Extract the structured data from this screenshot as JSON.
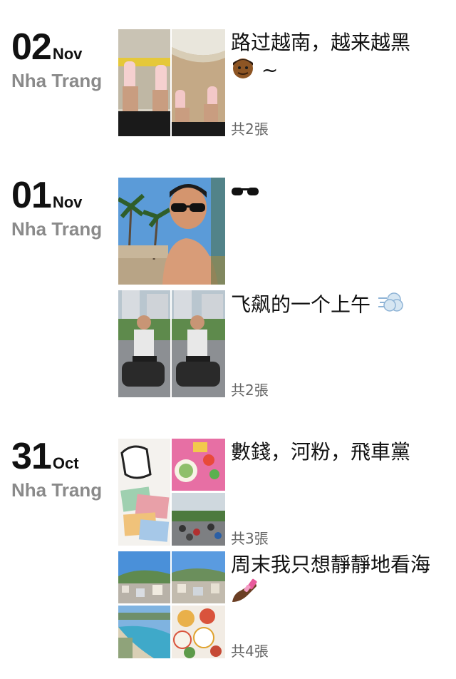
{
  "entries": [
    {
      "day": "02",
      "month": "Nov",
      "place": "Nha Trang",
      "posts": [
        {
          "caption": "路过越南，越来越黑",
          "caption_tail": "~",
          "caption_icon": "man-dark-skin-emoji",
          "count": "共2張"
        }
      ]
    },
    {
      "day": "01",
      "month": "Nov",
      "place": "Nha Trang",
      "posts": [
        {
          "caption": "",
          "caption_icon": "sunglasses-emoji"
        },
        {
          "caption": "飞飙的一个上午",
          "caption_icon": "dash-emoji",
          "count": "共2張"
        }
      ]
    },
    {
      "day": "31",
      "month": "Oct",
      "place": "Nha Trang",
      "posts": [
        {
          "caption": "數錢，河粉，飛車黨",
          "count": "共3張"
        },
        {
          "caption": "周末我只想靜靜地看海",
          "caption_icon": "nail-polish-emoji",
          "count": "共4張"
        }
      ]
    }
  ]
}
